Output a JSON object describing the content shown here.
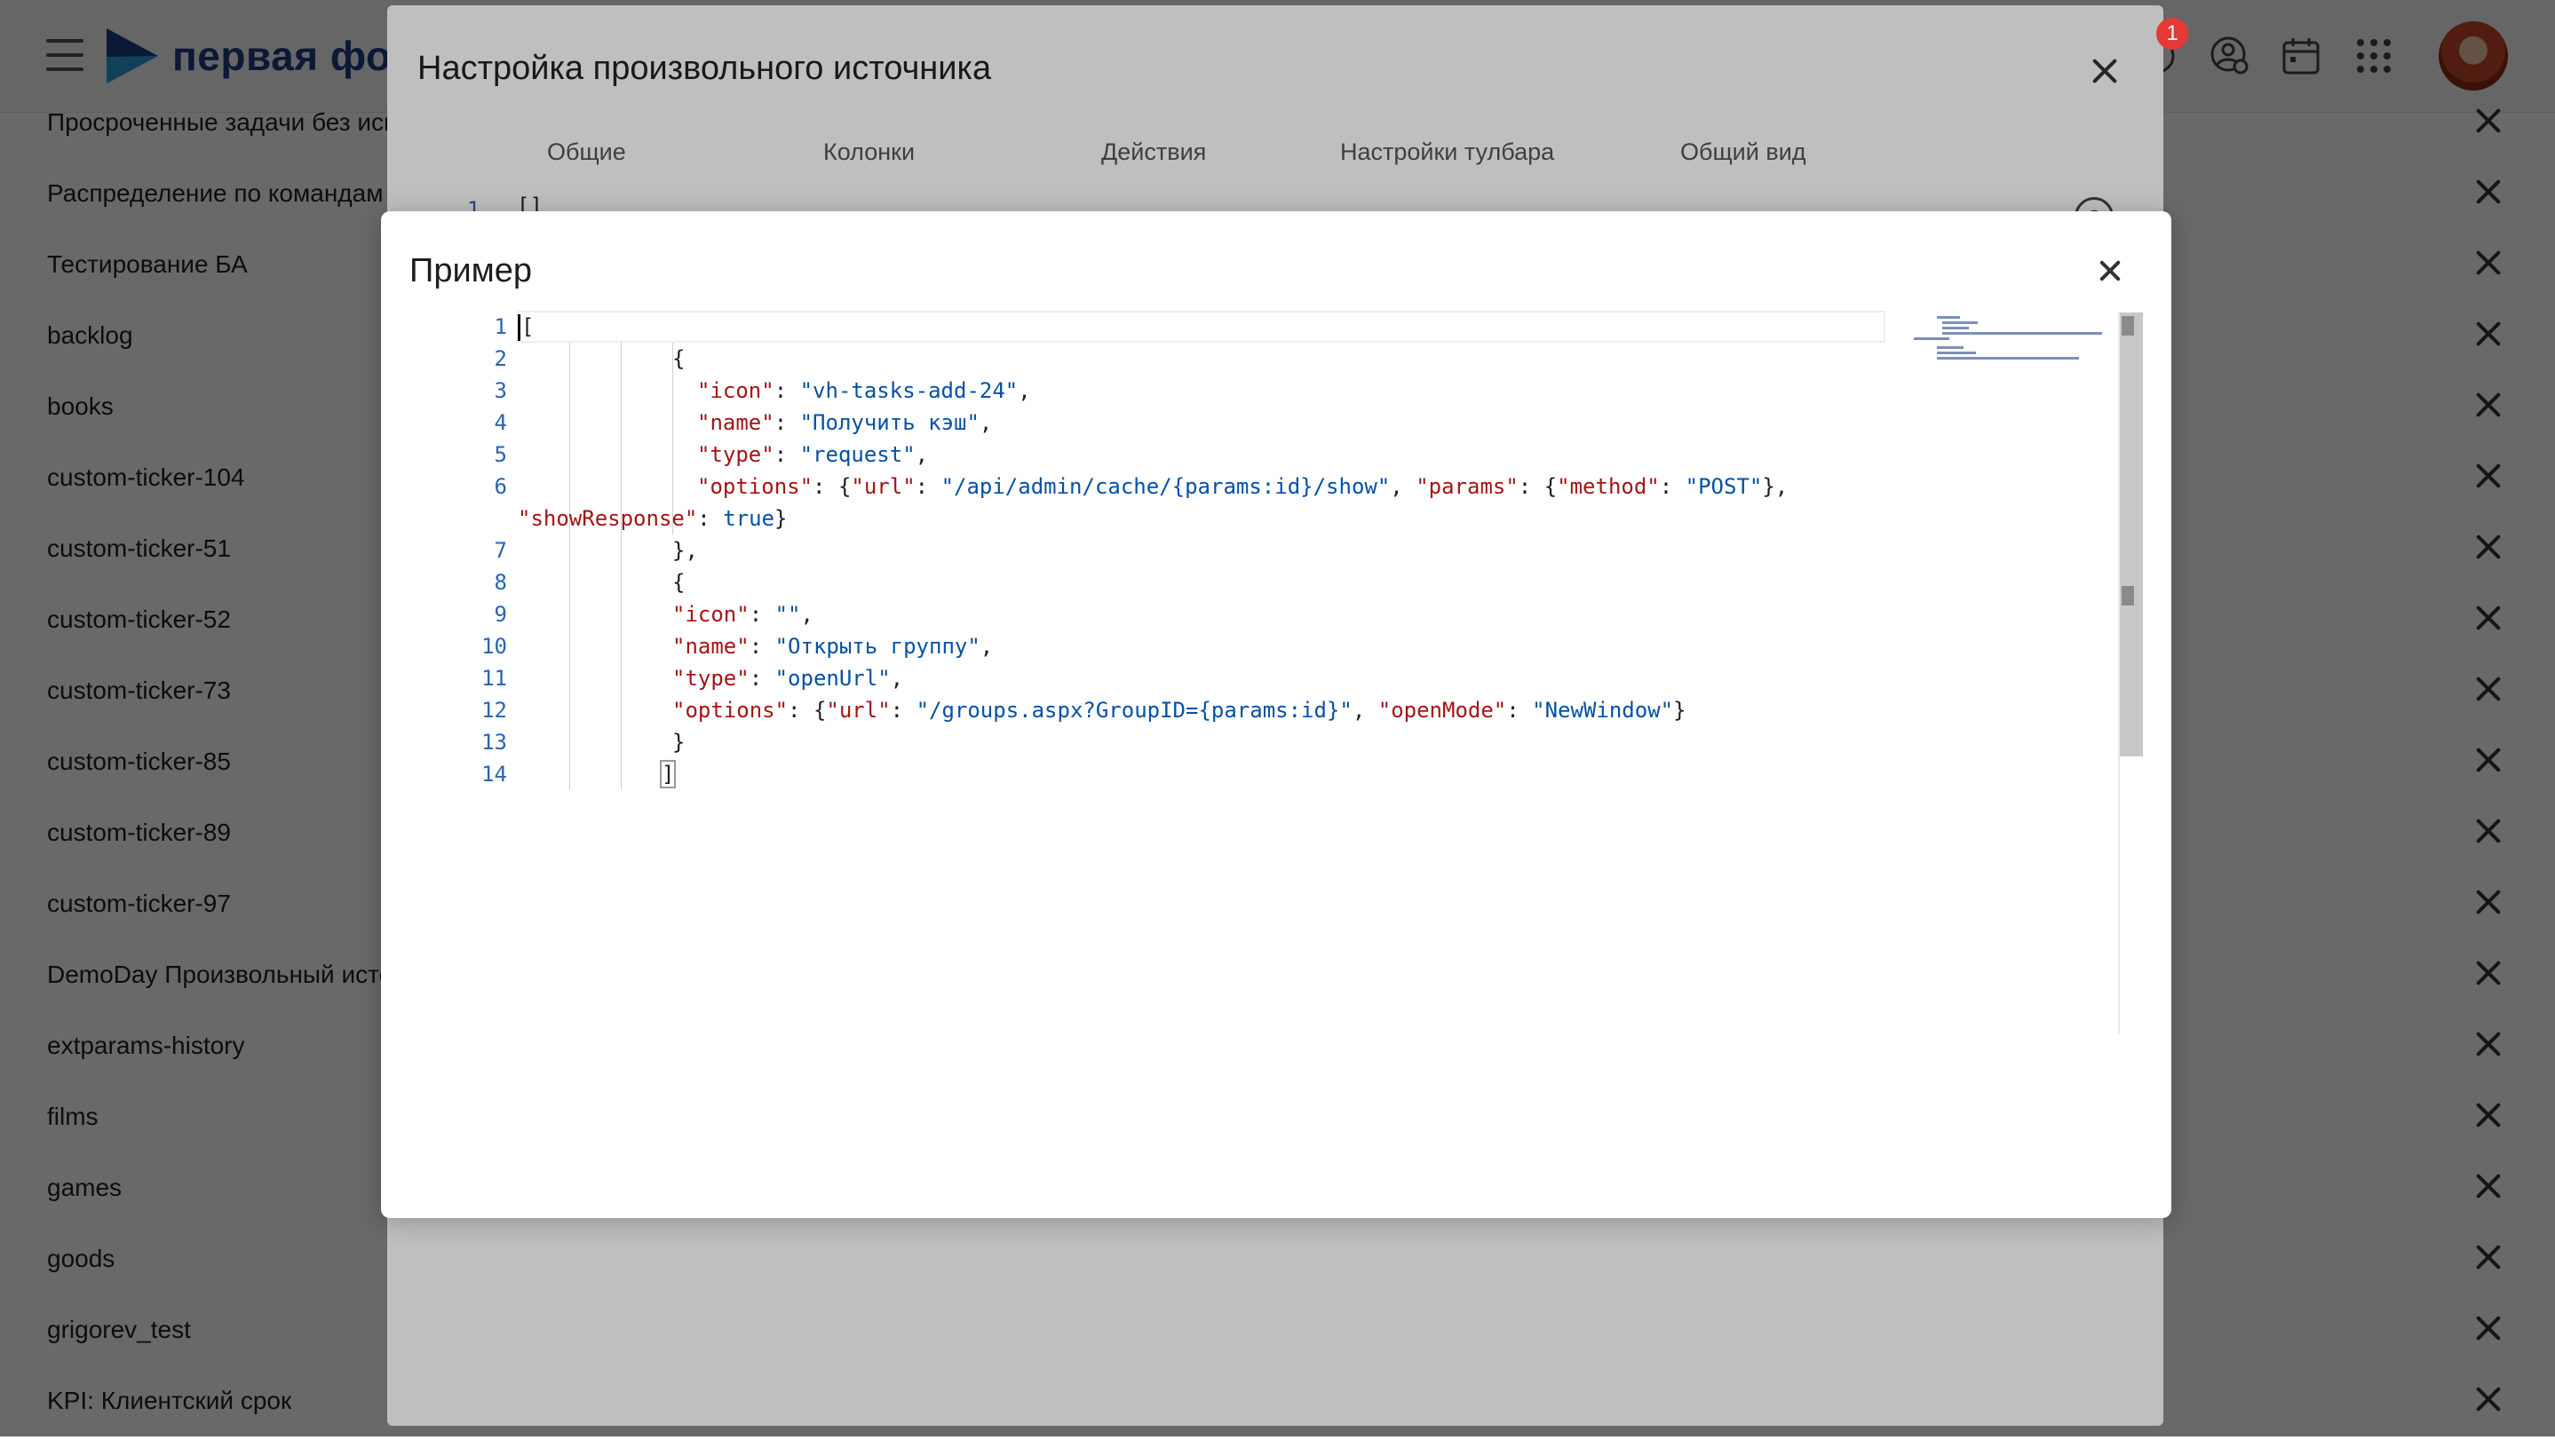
{
  "header": {
    "logo_text": "первая фор",
    "notification_count": "1"
  },
  "sources": [
    {
      "label": "Просроченные задачи без исп"
    },
    {
      "label": "Распределение по командам С"
    },
    {
      "label": "Тестирование БА"
    },
    {
      "label": "backlog"
    },
    {
      "label": "books"
    },
    {
      "label": "custom-ticker-104"
    },
    {
      "label": "custom-ticker-51"
    },
    {
      "label": "custom-ticker-52"
    },
    {
      "label": "custom-ticker-73"
    },
    {
      "label": "custom-ticker-85"
    },
    {
      "label": "custom-ticker-89"
    },
    {
      "label": "custom-ticker-97"
    },
    {
      "label": "DemoDay Произвольный исто"
    },
    {
      "label": "extparams-history"
    },
    {
      "label": "films"
    },
    {
      "label": "games"
    },
    {
      "label": "goods"
    },
    {
      "label": "grigorev_test"
    },
    {
      "label": "KPI: Клиентский срок"
    }
  ],
  "settings_dialog": {
    "title": "Настройка произвольного источника",
    "tabs": [
      {
        "label": "Общие"
      },
      {
        "label": "Колонки"
      },
      {
        "label": "Действия"
      },
      {
        "label": "Настройки тулбара"
      },
      {
        "label": "Общий вид"
      }
    ],
    "editor_line_number": "1",
    "editor_value": "[]",
    "help_label": "?"
  },
  "example_dialog": {
    "title": "Пример",
    "line_numbers": [
      "1",
      "2",
      "3",
      "4",
      "5",
      "6",
      "7",
      "8",
      "9",
      "10",
      "11",
      "12",
      "13",
      "14"
    ],
    "code": {
      "l1_open": "[",
      "l2": "{",
      "l3_key": "\"icon\"",
      "l3_val": "\"vh-tasks-add-24\"",
      "l4_key": "\"name\"",
      "l4_val": "\"Получить кэш\"",
      "l5_key": "\"type\"",
      "l5_val": "\"request\"",
      "l6_key": "\"options\"",
      "l6_k_url": "\"url\"",
      "l6_v_url": "\"/api/admin/cache/{params:id}/show\"",
      "l6_k_params": "\"params\"",
      "l6_k_method": "\"method\"",
      "l6_v_method": "\"POST\"",
      "l6_k_show": "\"showResponse\"",
      "l6_v_show": "true",
      "l7": "},",
      "l8": "{",
      "l9_key": "\"icon\"",
      "l9_val": "\"\"",
      "l10_key": "\"name\"",
      "l10_val": "\"Открыть группу\"",
      "l11_key": "\"type\"",
      "l11_val": "\"openUrl\"",
      "l12_key": "\"options\"",
      "l12_k_url": "\"url\"",
      "l12_v_url": "\"/groups.aspx?GroupID={params:id}\"",
      "l12_k_mode": "\"openMode\"",
      "l12_v_mode": "\"NewWindow\"",
      "l13": "}",
      "l14": "]"
    }
  },
  "icons": {
    "menu": "hamburger-icon",
    "logo": "play-logo-icon",
    "notifications": "bell-icon",
    "user_settings": "user-settings-icon",
    "calendar": "calendar-icon",
    "apps": "apps-grid-icon",
    "close": "close-icon",
    "delete": "close-icon",
    "help": "help-circle-icon"
  },
  "colors": {
    "brand": "#1c3b84",
    "badge": "#e53935",
    "json_key": "#a31515",
    "json_string": "#0451a5",
    "line_number": "#2a64b4"
  }
}
